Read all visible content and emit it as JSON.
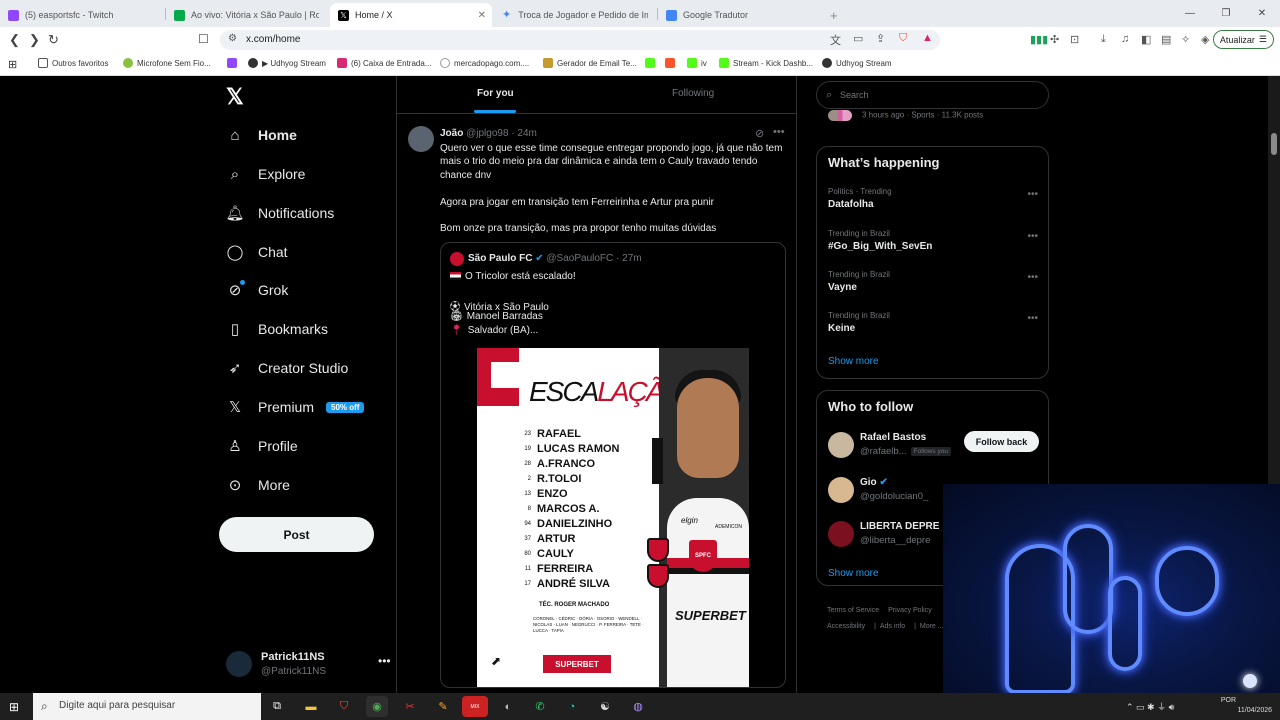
{
  "browser": {
    "tabs": [
      {
        "title": "(5) easportsfc - Twitch",
        "color": "#9146ff"
      },
      {
        "title": "Ao vivo: Vitória x São Paulo | Rodada",
        "color": "#06aa48"
      },
      {
        "title": "Home / X",
        "color": "#000000"
      },
      {
        "title": "Troca de Jogador e Pedido de Imagem",
        "color": "#4285f4"
      },
      {
        "title": "Google Tradutor",
        "color": "#4285f4"
      }
    ],
    "new_tab": "+",
    "url": "x.com/home",
    "update_button": "Atualizar",
    "bookmarks": [
      "Outros favoritos",
      "Microfone Sem Fio...",
      "▶ Udhyog Stream",
      "(6) Caixa de Entrada...",
      "mercadopago.com....",
      "Gerador de Email Te...",
      "iv",
      "Stream - Kick Dashb...",
      "Udhyog Stream"
    ]
  },
  "nav": {
    "items": [
      {
        "label": "Home",
        "icon": "home-icon"
      },
      {
        "label": "Explore",
        "icon": "search-icon"
      },
      {
        "label": "Notifications",
        "icon": "bell-icon"
      },
      {
        "label": "Chat",
        "icon": "chat-icon"
      },
      {
        "label": "Grok",
        "icon": "grok-icon"
      },
      {
        "label": "Bookmarks",
        "icon": "bookmark-icon"
      },
      {
        "label": "Creator Studio",
        "icon": "rocket-icon"
      },
      {
        "label": "Premium",
        "icon": "x-icon"
      },
      {
        "label": "Profile",
        "icon": "person-icon"
      },
      {
        "label": "More",
        "icon": "more-circle-icon"
      }
    ],
    "premium_badge": "50% off",
    "post_button": "Post",
    "account": {
      "name": "Patrick11NS",
      "handle": "@Patrick11NS"
    }
  },
  "feed": {
    "tabs": [
      "For you",
      "Following"
    ],
    "tweet": {
      "name": "João",
      "handle": "@jplgo98",
      "time": "· 24m",
      "lines": [
        "Quero ver o que esse time consegue entregar propondo jogo, já que não tem",
        "mais o trio do meio pra dar dinâmica e ainda tem o Cauly travado tendo",
        "chance dnv",
        "Agora pra jogar em transição tem Ferreirinha e Artur pra punir",
        "Bom onze pra transição, mas pra propor tenho muitas dúvidas"
      ],
      "quote": {
        "name": "São Paulo FC",
        "handle": "@SaoPauloFC",
        "time": "· 27m",
        "lines": [
          "O Tricolor está escalado!",
          "Vitória x São Paulo",
          "Manoel Barradas",
          "Salvador (BA)..."
        ],
        "poster": {
          "title_a": "ESCA",
          "title_b": "LAÇÃO",
          "players": [
            {
              "num": "23",
              "name": "RAFAEL"
            },
            {
              "num": "19",
              "name": "LUCAS RAMON"
            },
            {
              "num": "28",
              "name": "A.FRANCO"
            },
            {
              "num": "2",
              "name": "R.TOLOI"
            },
            {
              "num": "13",
              "name": "ENZO"
            },
            {
              "num": "8",
              "name": "MARCOS A."
            },
            {
              "num": "94",
              "name": "DANIELZINHO"
            },
            {
              "num": "37",
              "name": "ARTUR"
            },
            {
              "num": "80",
              "name": "CAULY"
            },
            {
              "num": "11",
              "name": "FERREIRA"
            },
            {
              "num": "17",
              "name": "ANDRÉ SILVA"
            }
          ],
          "coach": "TÉC. ROGER MACHADO",
          "bench": "CORONEL · CÉDRIC · DÓRIA · OSORIO · WENDELL · NICOLAS · LUAN · NEGRUCCI · P. FERREIRA · TETE · LUCCA · TAPIA",
          "sponsor": "SUPERBET",
          "shirt_brand": "elgin",
          "shirt_sponsor": "SUPERBET",
          "shirt_crest": "SPFC",
          "shirt_logo": "ADEMICON"
        }
      }
    }
  },
  "right": {
    "search_placeholder": "Search",
    "peek": "3 hours ago · Sports · 11.3K posts",
    "whats_happening_title": "What’s happening",
    "trends": [
      {
        "context": "Politics · Trending",
        "name": "Datafolha"
      },
      {
        "context": "Trending in Brazil",
        "name": "#Go_Big_With_SevEn"
      },
      {
        "context": "Trending in Brazil",
        "name": "Vayne"
      },
      {
        "context": "Trending in Brazil",
        "name": "Keine"
      }
    ],
    "show_more": "Show more",
    "who_to_follow_title": "Who to follow",
    "follow": [
      {
        "name": "Rafael Bastos",
        "handle": "@rafaelb...",
        "follows_you": "Follows you",
        "button": "Follow back"
      },
      {
        "name": "Gio",
        "handle": "@goldolucian0_"
      },
      {
        "name": "LIBERTA DEPRE",
        "handle": "@liberta__depre"
      }
    ],
    "footer": [
      "Terms of Service",
      "Privacy Policy",
      "Accessibility",
      "Ads info",
      "More ..."
    ]
  },
  "taskbar": {
    "search_placeholder": "Digite aqui para pesquisar",
    "lang": "POR",
    "date": "11/04/2026"
  }
}
